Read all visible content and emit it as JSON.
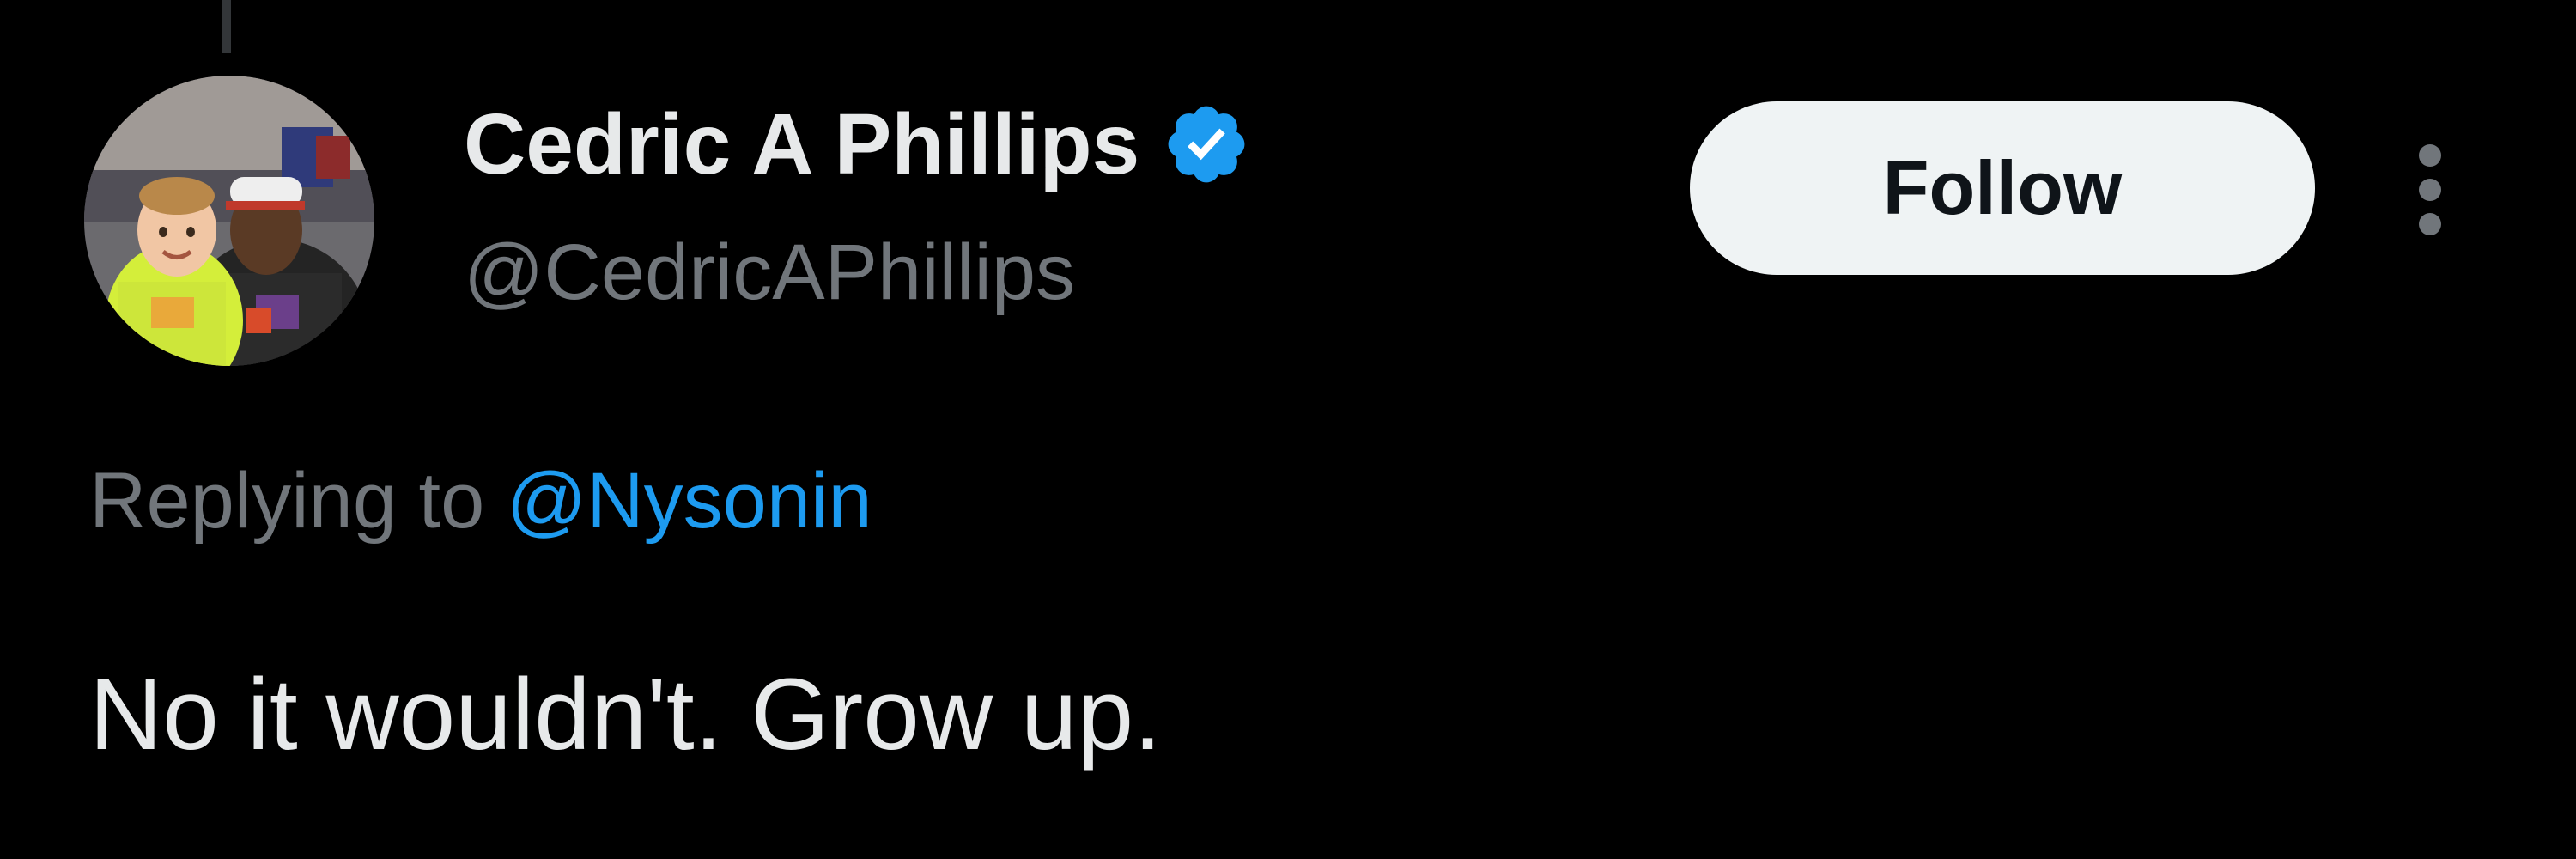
{
  "tweet": {
    "author": {
      "display_name": "Cedric A Phillips",
      "handle": "@CedricAPhillips",
      "verified": true,
      "verified_icon": "verified-badge-icon",
      "verified_color": "#1d9bf0"
    },
    "follow_label": "Follow",
    "more_icon": "more-vertical-icon",
    "replying_prefix": "Replying to",
    "replying_handle": "@Nysonin",
    "text": "No it wouldn't. Grow up."
  },
  "colors": {
    "background": "#000000",
    "primary_text": "#e7e9ea",
    "secondary_text": "#71767b",
    "link": "#1d9bf0",
    "follow_button_bg": "#eff3f4",
    "follow_button_text": "#0f1419"
  }
}
